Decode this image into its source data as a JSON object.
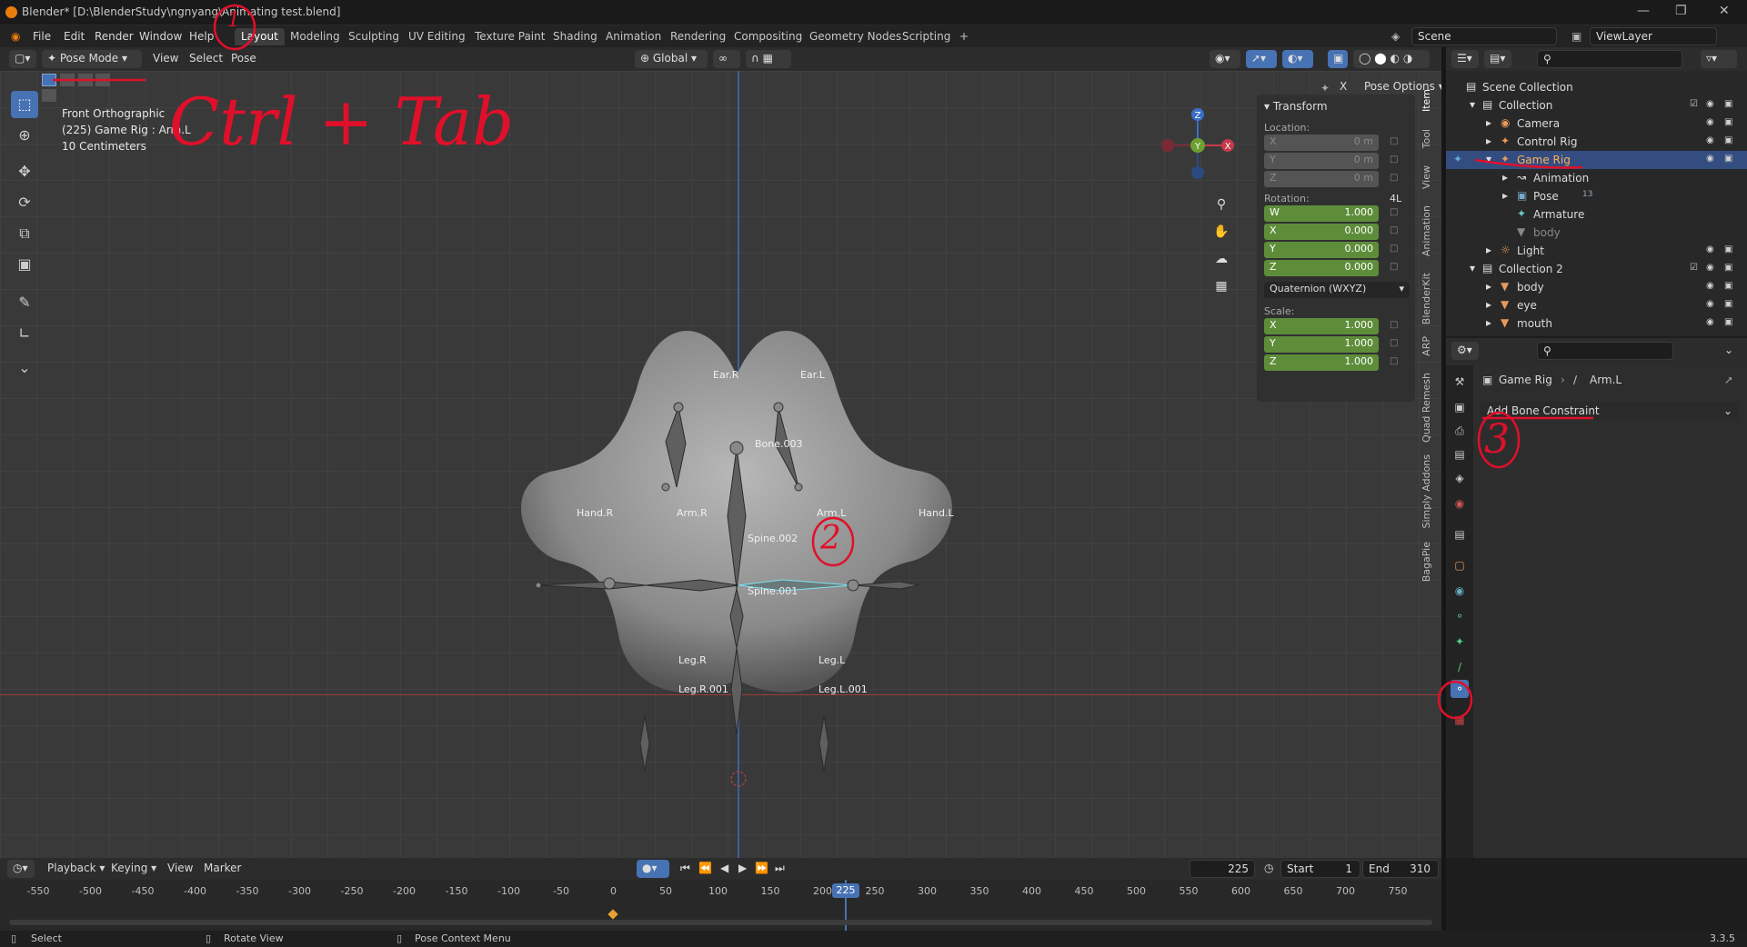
{
  "window": {
    "title": "Blender* [D:\\BlenderStudy\\ngnyang\\Animating test.blend]"
  },
  "menu": [
    "File",
    "Edit",
    "Render",
    "Window",
    "Help"
  ],
  "workspaces": [
    "Layout",
    "Modeling",
    "Sculpting",
    "UV Editing",
    "Texture Paint",
    "Shading",
    "Animation",
    "Rendering",
    "Compositing",
    "Geometry Nodes",
    "Scripting",
    "+"
  ],
  "scene": {
    "label": "Scene",
    "view_layer": "ViewLayer"
  },
  "viewport_header": {
    "mode": "Pose Mode",
    "menus": [
      "View",
      "Select",
      "Pose"
    ],
    "orientation": "Global",
    "pose_options": "Pose Options"
  },
  "viewport_info": {
    "view": "Front Orthographic",
    "object": "(225) Game Rig : Arm.L",
    "scale": "10 Centimeters"
  },
  "transform": {
    "title": "Transform",
    "location_label": "Location:",
    "location": [
      {
        "axis": "X",
        "value": "0 m"
      },
      {
        "axis": "Y",
        "value": "0 m"
      },
      {
        "axis": "Z",
        "value": "0 m"
      }
    ],
    "rotation_label": "Rotation:",
    "rotation_mode_short": "4L",
    "rotation": [
      {
        "axis": "W",
        "value": "1.000"
      },
      {
        "axis": "X",
        "value": "0.000"
      },
      {
        "axis": "Y",
        "value": "0.000"
      },
      {
        "axis": "Z",
        "value": "0.000"
      }
    ],
    "rotation_mode": "Quaternion (WXYZ)",
    "scale_label": "Scale:",
    "scale": [
      {
        "axis": "X",
        "value": "1.000"
      },
      {
        "axis": "Y",
        "value": "1.000"
      },
      {
        "axis": "Z",
        "value": "1.000"
      }
    ]
  },
  "side_tabs": [
    "Item",
    "Tool",
    "View",
    "Animation",
    "BlenderKit",
    "ARP",
    "Quad Remesh",
    "Simply Addons",
    "BagaPie"
  ],
  "gizmo": {
    "x": "X",
    "y": "Y",
    "z": "Z"
  },
  "bones": {
    "ear_r": "Ear.R",
    "ear_l": "Ear.L",
    "bone003": "Bone.003",
    "hand_r": "Hand.R",
    "arm_r": "Arm.R",
    "arm_l": "Arm.L",
    "hand_l": "Hand.L",
    "spine002": "Spine.002",
    "spine001": "Spine.001",
    "leg_r": "Leg.R",
    "leg_l": "Leg.L",
    "leg_r001": "Leg.R.001",
    "leg_l001": "Leg.L.001"
  },
  "outliner": {
    "rows": [
      {
        "label": "Scene Collection"
      },
      {
        "label": "Collection"
      },
      {
        "label": "Camera"
      },
      {
        "label": "Control Rig"
      },
      {
        "label": "Game Rig"
      },
      {
        "label": "Animation"
      },
      {
        "label": "Pose"
      },
      {
        "label": "Armature"
      },
      {
        "label": "body"
      },
      {
        "label": "Light"
      },
      {
        "label": "Collection 2"
      },
      {
        "label": "body"
      },
      {
        "label": "eye"
      },
      {
        "label": "mouth"
      }
    ],
    "pose_count": "13"
  },
  "properties": {
    "breadcrumb_object": "Game Rig",
    "breadcrumb_bone": "Arm.L",
    "add_constraint": "Add Bone Constraint"
  },
  "timeline": {
    "menus": [
      "Playback",
      "Keying",
      "View",
      "Marker"
    ],
    "current_frame": "225",
    "start_label": "Start",
    "start": "1",
    "end_label": "End",
    "end": "310",
    "ticks": [
      "-550",
      "-500",
      "-450",
      "-400",
      "-350",
      "-300",
      "-250",
      "-200",
      "-150",
      "-100",
      "-50",
      "0",
      "50",
      "100",
      "150",
      "200",
      "250",
      "300",
      "350",
      "400",
      "450",
      "500",
      "550",
      "600",
      "650",
      "700",
      "750"
    ]
  },
  "status_bar": {
    "select": "Select",
    "rotate": "Rotate View",
    "context": "Pose Context Menu",
    "version": "3.3.5"
  },
  "annotations": {
    "ctrl_tab": "Ctrl + Tab",
    "one": "1",
    "two": "2",
    "three": "3"
  },
  "colors": {
    "accent": "#4772b3",
    "selection": "#334d80",
    "annotation": "#e0102a",
    "green_field": "#5e8d3a"
  }
}
